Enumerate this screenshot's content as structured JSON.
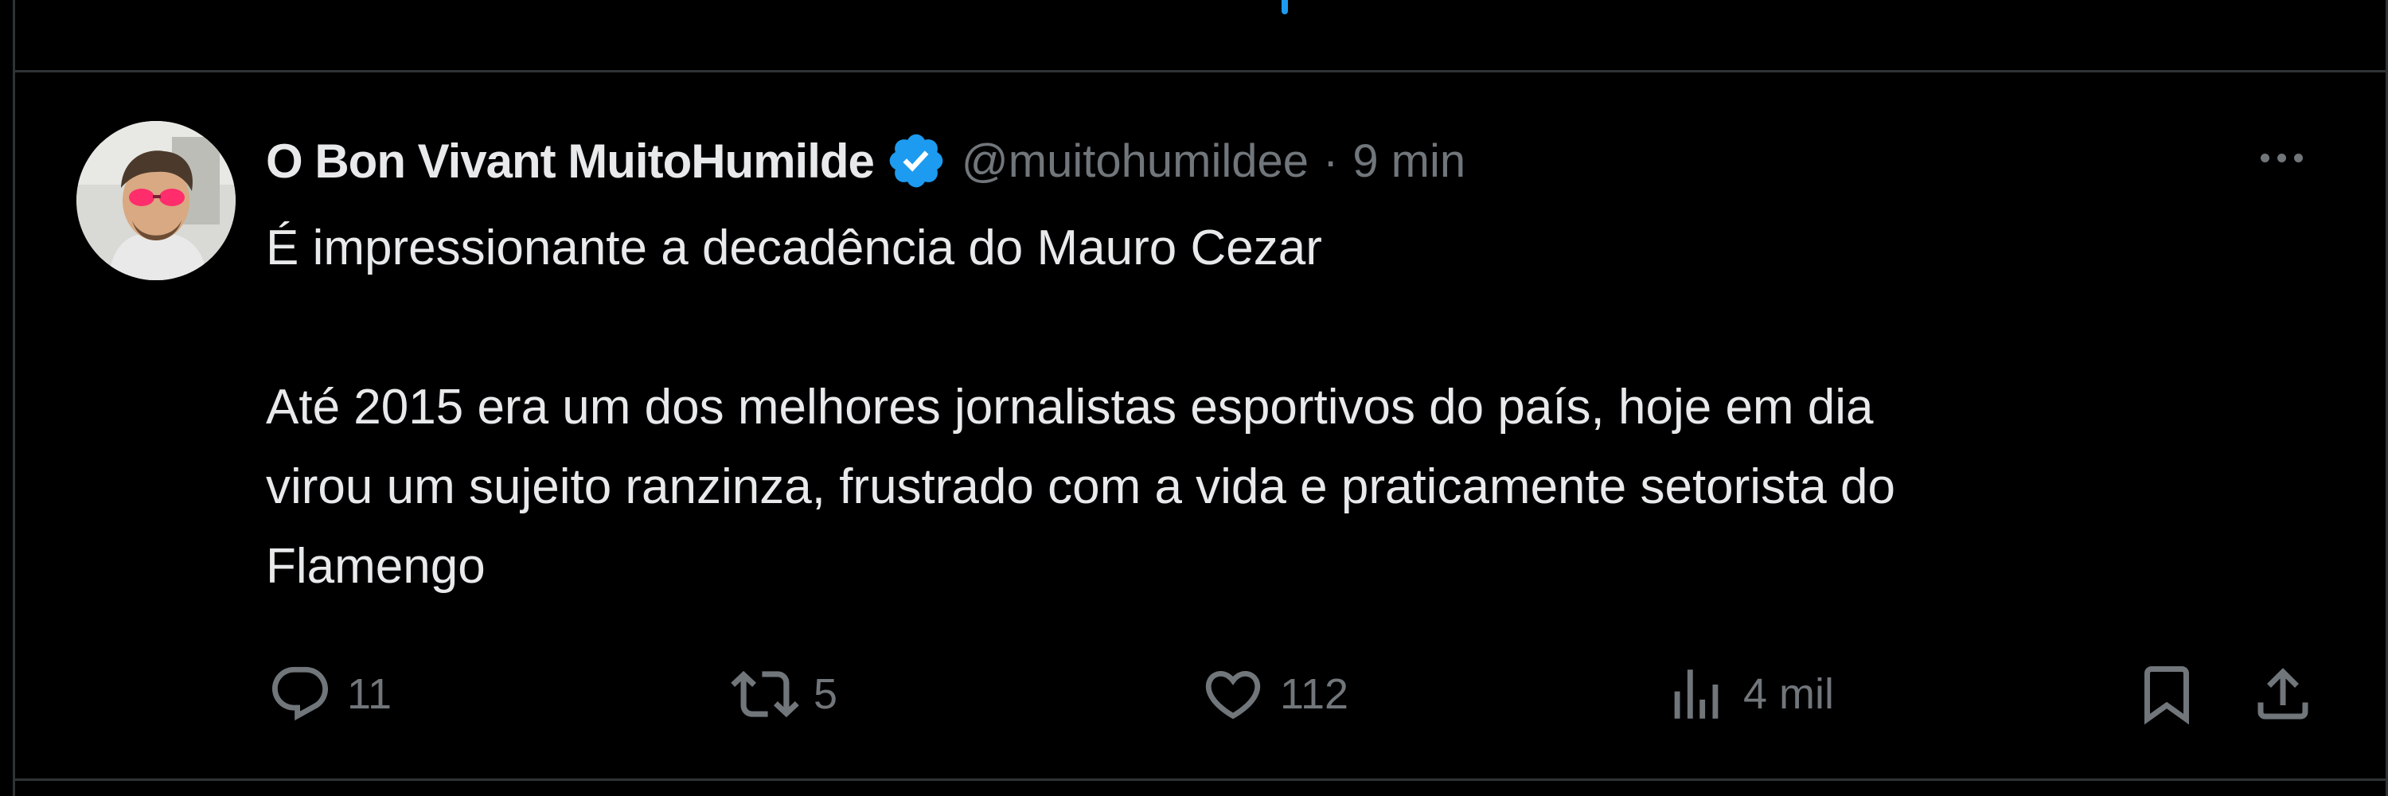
{
  "tweet": {
    "display_name": "O Bon Vivant MuitoHumilde",
    "handle": "@muitohumildee",
    "separator": "·",
    "time": "9 min",
    "paragraph_1": "É impressionante a decadência do Mauro Cezar",
    "paragraph_2_lines": [
      "Até 2015 era um dos melhores jornalistas esportivos do país, hoje em dia",
      "virou um sujeito ranzinza, frustrado com a vida e praticamente setorista do",
      "Flamengo"
    ]
  },
  "actions": {
    "replies": "11",
    "retweets": "5",
    "likes": "112",
    "views": "4 mil"
  },
  "icons": {
    "verified": "verified-badge-icon",
    "more": "more-dots-icon",
    "reply": "reply-icon",
    "retweet": "retweet-icon",
    "like": "heart-icon",
    "views": "views-chart-icon",
    "bookmark": "bookmark-icon",
    "share": "share-icon"
  },
  "colors": {
    "background": "#000000",
    "text_primary": "#e7e9ea",
    "text_secondary": "#71767b",
    "verified_blue": "#1d9bf0",
    "divider": "#2f3336"
  }
}
